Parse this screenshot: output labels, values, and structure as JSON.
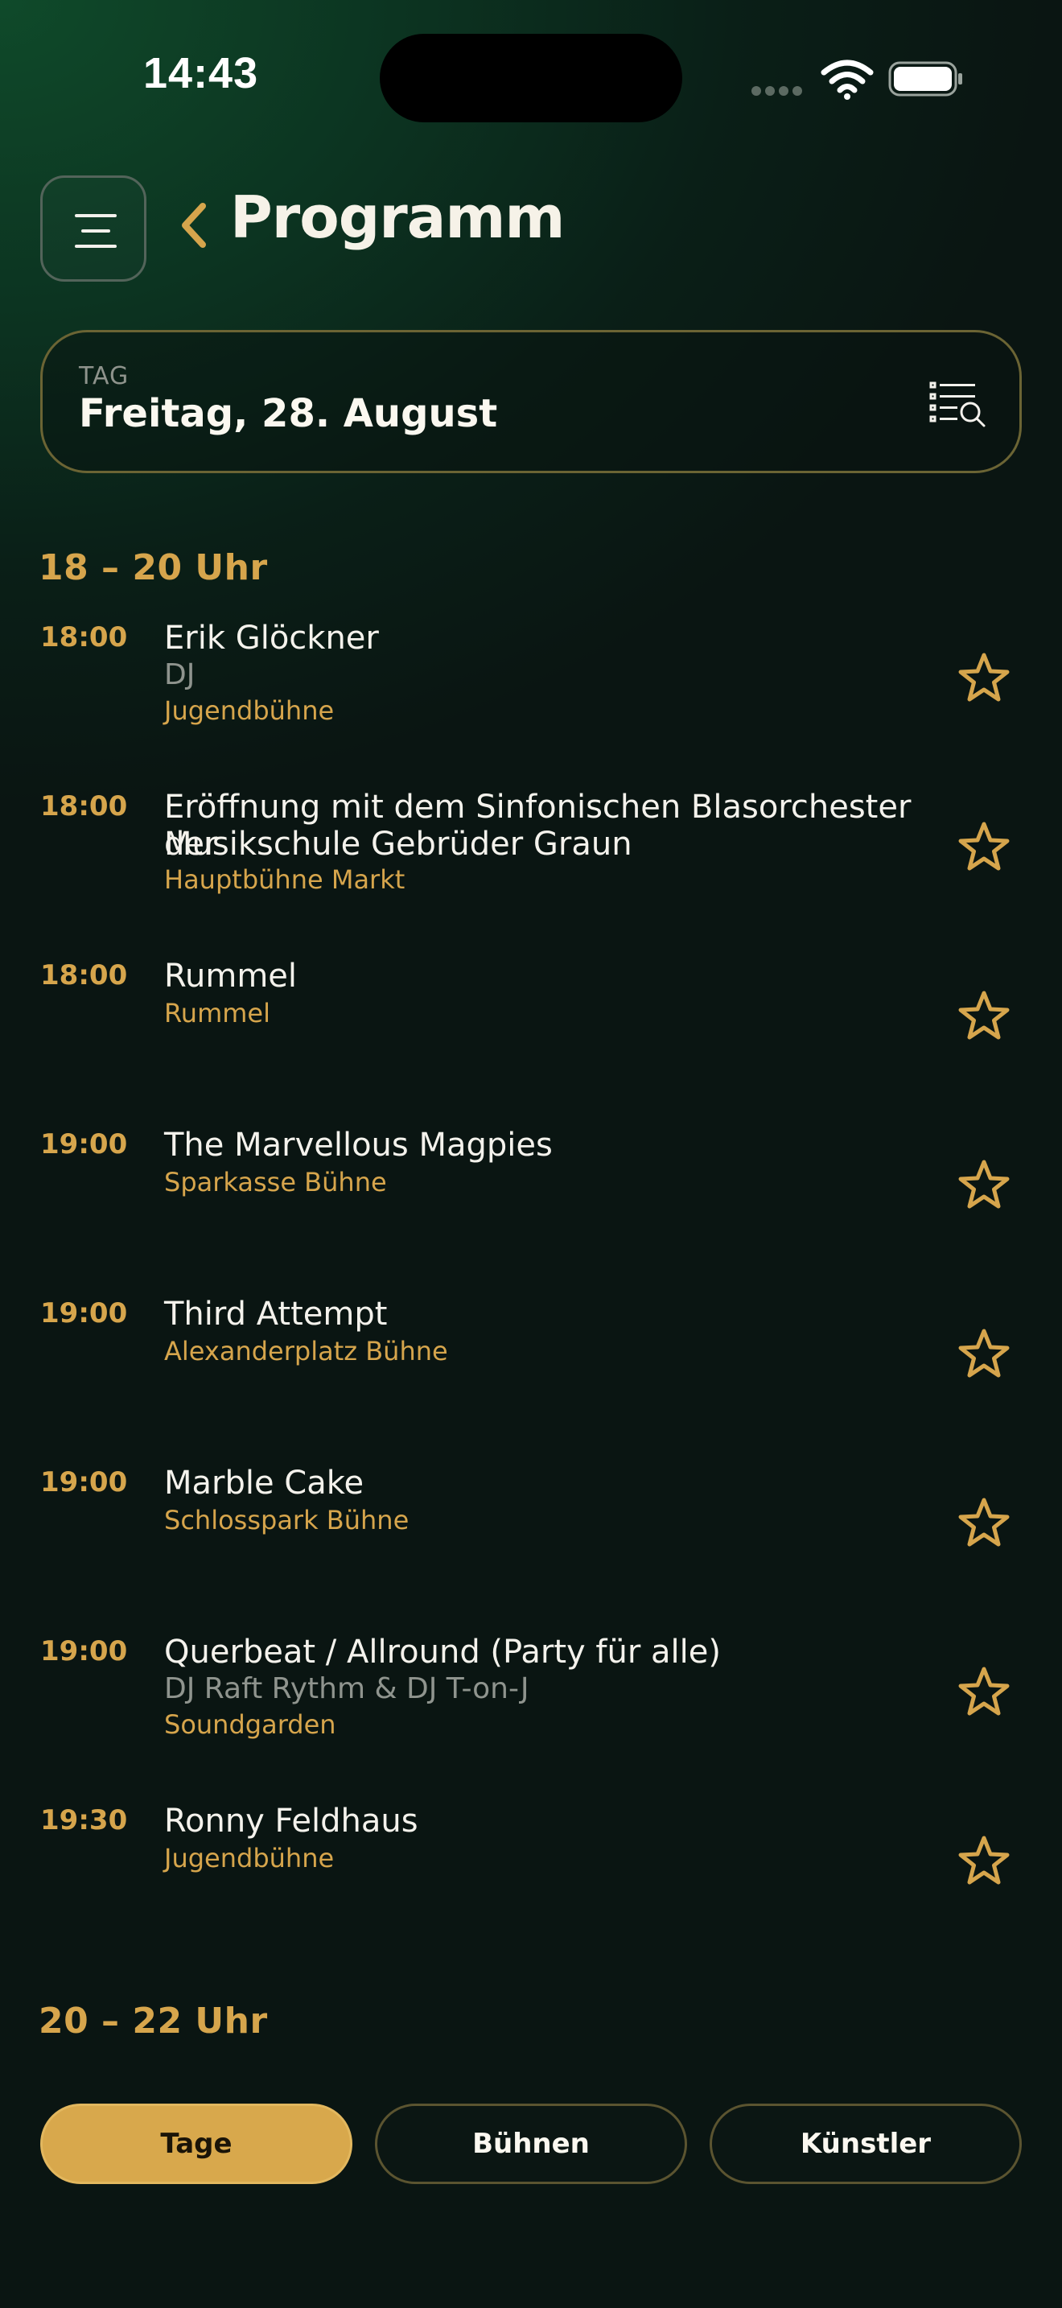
{
  "status_bar": {
    "time": "14:43"
  },
  "header": {
    "title": "Programm"
  },
  "day_selector": {
    "label": "TAG",
    "value": "Freitag, 28. August"
  },
  "sections": [
    {
      "heading": "18 – 20 Uhr",
      "items": [
        {
          "time": "18:00",
          "title": "Erik Glöckner",
          "subtitle": "DJ",
          "stage": "Jugendbühne"
        },
        {
          "time": "18:00",
          "title": "Eröffnung mit dem Sinfonischen Blasorchester der",
          "title_line2": "Musikschule Gebrüder Graun",
          "stage": "Hauptbühne Markt"
        },
        {
          "time": "18:00",
          "title": "Rummel",
          "stage": "Rummel"
        },
        {
          "time": "19:00",
          "title": "The Marvellous Magpies",
          "stage": "Sparkasse Bühne"
        },
        {
          "time": "19:00",
          "title": "Third Attempt",
          "stage": "Alexanderplatz Bühne"
        },
        {
          "time": "19:00",
          "title": "Marble Cake",
          "stage": "Schlosspark Bühne"
        },
        {
          "time": "19:00",
          "title": "Querbeat / Allround (Party für alle)",
          "subtitle": "DJ Raft Rythm & DJ T-on-J",
          "stage": "Soundgarden"
        },
        {
          "time": "19:30",
          "title": "Ronny Feldhaus",
          "stage": "Jugendbühne"
        }
      ]
    },
    {
      "heading": "20 – 22 Uhr"
    }
  ],
  "tabs": [
    {
      "label": "Tage",
      "active": true
    },
    {
      "label": "Bühnen",
      "active": false
    },
    {
      "label": "Künstler",
      "active": false
    }
  ],
  "colors": {
    "accent": "#d6a54c",
    "background": "#0a1512",
    "text": "#f4f2ec",
    "muted": "#8f948e"
  },
  "icons": [
    "menu-icon",
    "chevron-left-icon",
    "list-search-icon",
    "star-icon",
    "wifi-icon",
    "battery-icon"
  ]
}
